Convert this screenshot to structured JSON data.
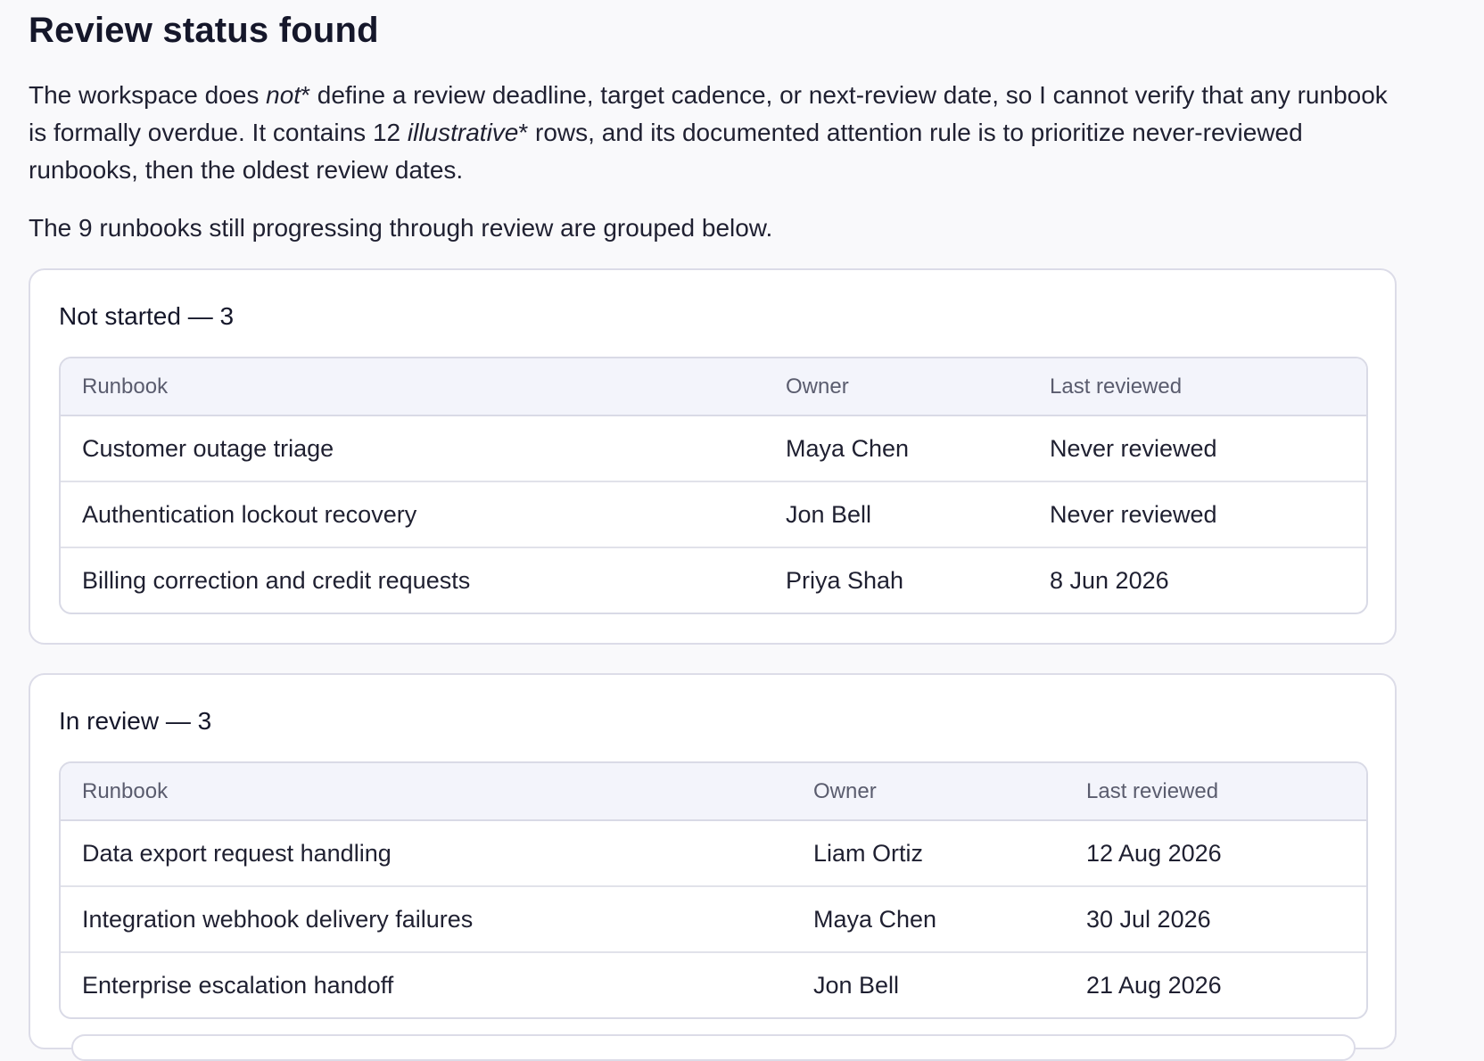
{
  "title": "Review status found",
  "intro": {
    "part1": "The workspace does ",
    "em1": "not",
    "part2": "* define a review deadline, target cadence, or next-review date, so I cannot verify that any runbook is formally overdue. It contains 12 ",
    "em2": "illustrative",
    "part3": "* rows, and its documented attention rule is to prioritize never-reviewed runbooks, then the oldest review dates."
  },
  "summary": "The 9 runbooks still progressing through review are grouped below.",
  "groups": [
    {
      "title": "Not started — 3",
      "headers": [
        "Runbook",
        "Owner",
        "Last reviewed"
      ],
      "rows": [
        [
          "Customer outage triage",
          "Maya Chen",
          "Never reviewed"
        ],
        [
          "Authentication lockout recovery",
          "Jon Bell",
          "Never reviewed"
        ],
        [
          "Billing correction and credit requests",
          "Priya Shah",
          "8 Jun 2026"
        ]
      ]
    },
    {
      "title": "In review — 3",
      "headers": [
        "Runbook",
        "Owner",
        "Last reviewed"
      ],
      "rows": [
        [
          "Data export request handling",
          "Liam Ortiz",
          "12 Aug 2026"
        ],
        [
          "Integration webhook delivery failures",
          "Maya Chen",
          "30 Jul 2026"
        ],
        [
          "Enterprise escalation handoff",
          "Jon Bell",
          "21 Aug 2026"
        ]
      ]
    }
  ]
}
